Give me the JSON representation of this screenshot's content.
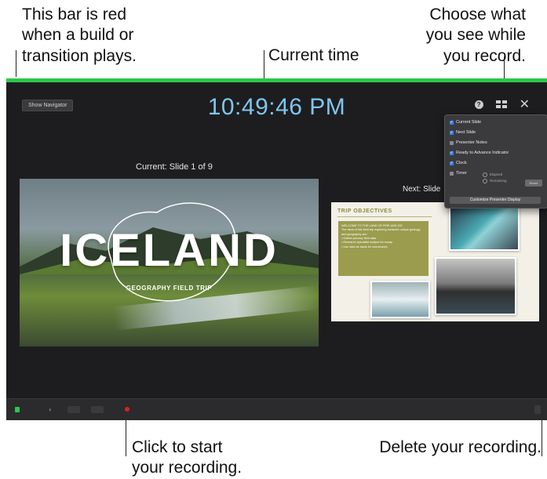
{
  "callouts": {
    "red_bar": "This bar is red\nwhen a build or\ntransition plays.",
    "current_time": "Current time",
    "choose_view": "Choose what\nyou see while\nyou record.",
    "start_recording": "Click to start\nyour recording.",
    "delete_recording": "Delete your recording."
  },
  "toolbar": {
    "show_navigator": "Show Navigator",
    "clock": "10:49:46 PM"
  },
  "current": {
    "label": "Current: Slide 1 of 9",
    "title": "ICELAND",
    "subtitle": "GEOGRAPHY FIELD TRIP"
  },
  "next": {
    "label": "Next: Slide",
    "title": "TRIP OBJECTIVES",
    "body": "WELCOME TO THE LAND OF FIRE AND ICE\nThe aims of this field trip exploring Iceland's unique geology and geography are:\n• Gather primary field data\n• Research specialist subject for essay\n• Use data as basis for coursework"
  },
  "popover": {
    "items": [
      {
        "label": "Current Slide",
        "checked": true
      },
      {
        "label": "Next Slide",
        "checked": true
      },
      {
        "label": "Presenter Notes",
        "checked": false
      },
      {
        "label": "Ready to Advance Indicator",
        "checked": true
      },
      {
        "label": "Clock",
        "checked": true
      },
      {
        "label": "Timer",
        "checked": false
      }
    ],
    "timer_options": [
      "Elapsed",
      "Remaining"
    ],
    "reset_label": "Reset",
    "customize_label": "Customize Presenter Display"
  },
  "colors": {
    "status_bar": "#2bc84a",
    "clock": "#7fc6ef",
    "record": "#e02020"
  }
}
